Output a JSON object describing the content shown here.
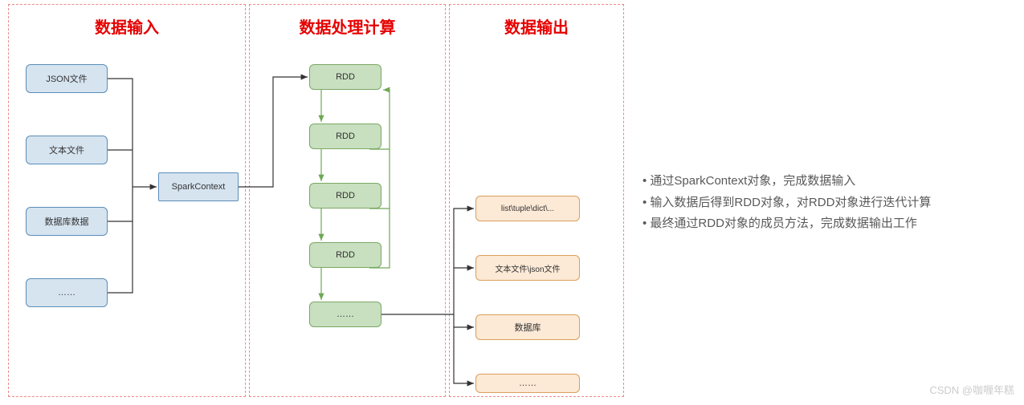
{
  "sections": {
    "input": {
      "title": "数据输入"
    },
    "process": {
      "title": "数据处理计算"
    },
    "output": {
      "title": "数据输出"
    }
  },
  "inputs": {
    "b0": "JSON文件",
    "b1": "文本文件",
    "b2": "数据库数据",
    "b3": "……",
    "context": "SparkContext"
  },
  "rdds": {
    "r0": "RDD",
    "r1": "RDD",
    "r2": "RDD",
    "r3": "RDD",
    "r4": "……"
  },
  "outputs": {
    "o0": "list\\tuple\\dict\\...",
    "o1": "文本文件\\json文件",
    "o2": "数据库",
    "o3": "……"
  },
  "notes": {
    "n0": "通过SparkContext对象，完成数据输入",
    "n1": "输入数据后得到RDD对象，对RDD对象进行迭代计算",
    "n2": "最终通过RDD对象的成员方法，完成数据输出工作"
  },
  "watermark": "CSDN @咖喱年糕"
}
